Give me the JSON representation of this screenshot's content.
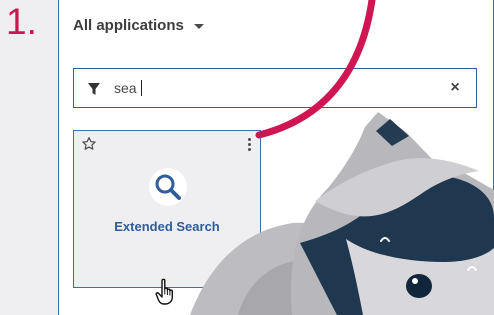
{
  "step": {
    "number": "1."
  },
  "header": {
    "app_filter_label": "All applications",
    "app_filter_icon": "chevron-down-icon"
  },
  "search": {
    "value": "sea",
    "filter_icon": "filter-icon",
    "clear_icon": "close-icon"
  },
  "tile": {
    "label": "Extended Search",
    "icon": "magnifier-icon",
    "favorite_icon": "star-icon",
    "menu_icon": "more-vertical-icon"
  },
  "colors": {
    "accent": "#d01553",
    "brand_blue": "#2f5d9a",
    "tile_bg": "#efeff1"
  },
  "cursor": {
    "icon": "hand-cursor-icon"
  },
  "mascot": {
    "icon": "raccoon-mascot"
  }
}
